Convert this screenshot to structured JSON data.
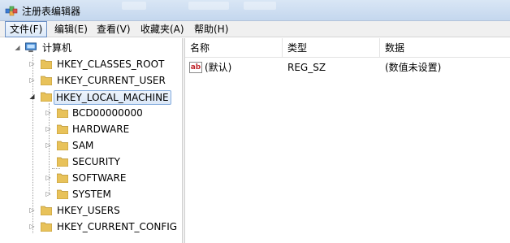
{
  "window": {
    "title": "注册表编辑器"
  },
  "menu": {
    "items": [
      {
        "label": "文件(F)"
      },
      {
        "label": "编辑(E)"
      },
      {
        "label": "查看(V)"
      },
      {
        "label": "收藏夹(A)"
      },
      {
        "label": "帮助(H)"
      }
    ]
  },
  "tree": {
    "root": "计算机",
    "nodes": [
      {
        "label": "HKEY_CLASSES_ROOT",
        "expanded": false
      },
      {
        "label": "HKEY_CURRENT_USER",
        "expanded": false
      },
      {
        "label": "HKEY_LOCAL_MACHINE",
        "expanded": true,
        "selected": true
      },
      {
        "label": "BCD00000000"
      },
      {
        "label": "HARDWARE"
      },
      {
        "label": "SAM"
      },
      {
        "label": "SECURITY"
      },
      {
        "label": "SOFTWARE"
      },
      {
        "label": "SYSTEM"
      },
      {
        "label": "HKEY_USERS",
        "expanded": false
      },
      {
        "label": "HKEY_CURRENT_CONFIG",
        "expanded": false
      }
    ]
  },
  "list": {
    "columns": [
      "名称",
      "类型",
      "数据"
    ],
    "rows": [
      {
        "name": "(默认)",
        "type": "REG_SZ",
        "data": "(数值未设置)",
        "icon": "string-value-icon"
      }
    ]
  },
  "colors": {
    "folder": "#e8c25a",
    "selection_border": "#84acdd",
    "titlebar": "#c4d7ee"
  }
}
